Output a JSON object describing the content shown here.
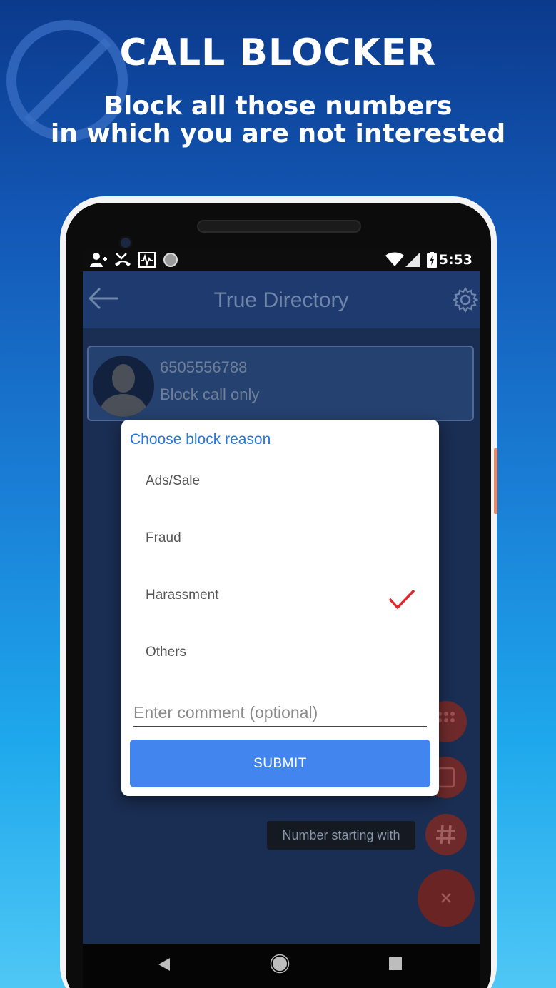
{
  "promo": {
    "headline": "CALL BLOCKER",
    "subline_1": "Block all those numbers",
    "subline_2": "in which you are not interested",
    "icon": "ban-icon"
  },
  "status_bar": {
    "time": "5:53",
    "left_icons": [
      "add-contact-icon",
      "missed-call-icon",
      "activity-icon",
      "circle-icon"
    ],
    "right_icons": [
      "wifi-icon",
      "signal-icon",
      "battery-icon"
    ]
  },
  "app_bar": {
    "title": "True Directory",
    "back_icon": "back-arrow-icon",
    "settings_icon": "gear-icon"
  },
  "contact": {
    "number": "6505556788",
    "status": "Block call only"
  },
  "tooltip": "Number starting with",
  "dialog": {
    "title": "Choose block reason",
    "reasons": [
      {
        "label": "Ads/Sale",
        "selected": false
      },
      {
        "label": "Fraud",
        "selected": false
      },
      {
        "label": "Harassment",
        "selected": true
      },
      {
        "label": "Others",
        "selected": false
      }
    ],
    "comment_placeholder": "Enter comment (optional)",
    "submit_label": "SUBMIT"
  },
  "colors": {
    "accent_blue": "#4285ef",
    "dialog_title": "#2477e0",
    "check_red": "#e0262c",
    "fab_red": "#6e2a2a"
  }
}
